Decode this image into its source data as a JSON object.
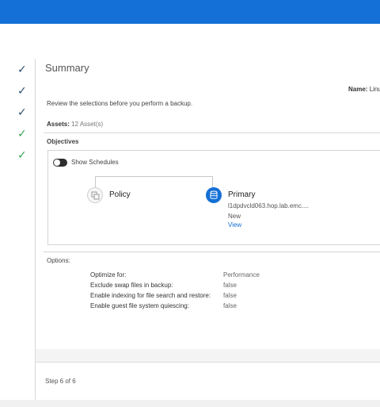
{
  "steps": [
    {
      "status": "complete"
    },
    {
      "status": "complete"
    },
    {
      "status": "complete"
    },
    {
      "status": "complete",
      "accent": "#3aa35a"
    },
    {
      "status": "complete",
      "accent": "#3aa35a"
    }
  ],
  "summary": {
    "title": "Summary",
    "name_label": "Name:",
    "name_value": "Linu",
    "review_text": "Review the selections before you perform a backup.",
    "assets_label": "Assets:",
    "assets_value": "12 Asset(s)"
  },
  "objectives": {
    "heading": "Objectives",
    "toggle_label": "Show Schedules",
    "toggle_on": false,
    "policy": {
      "label": "Policy",
      "icon": "copy-icon"
    },
    "primary": {
      "label": "Primary",
      "icon": "database-icon",
      "host": "l1dpdvcld063.hop.lab.emc....",
      "status": "New",
      "view_link": "View"
    }
  },
  "options": {
    "heading": "Options:",
    "rows": [
      {
        "key": "Optimize for:",
        "value": "Performance"
      },
      {
        "key": "Exclude swap files in backup:",
        "value": "false"
      },
      {
        "key": "Enable indexing for file search and restore:",
        "value": "false"
      },
      {
        "key": "Enable guest file system quiescing:",
        "value": "false"
      }
    ]
  },
  "footer": {
    "step_text": "Step 6 of 6"
  },
  "colors": {
    "brand": "#1470d6",
    "check": "#2f4f6f",
    "check_done": "#3aa35a"
  }
}
